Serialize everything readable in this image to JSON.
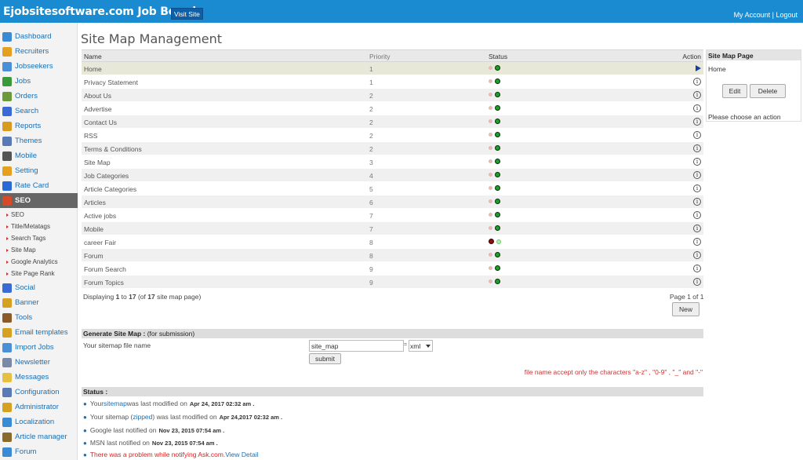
{
  "header": {
    "brand": "Ejobsitesoftware.com Job Board",
    "visit_site": "Visit Site",
    "my_account": "My Account",
    "separator": "|",
    "logout": "Logout"
  },
  "sidebar": {
    "items": [
      {
        "label": "Dashboard",
        "icon": "home-icon",
        "color": "#3a8ad6"
      },
      {
        "label": "Recruiters",
        "icon": "recruiter-icon",
        "color": "#e6a020"
      },
      {
        "label": "Jobseekers",
        "icon": "jobseekers-icon",
        "color": "#4a90d9"
      },
      {
        "label": "Jobs",
        "icon": "jobs-icon",
        "color": "#3a9a3a"
      },
      {
        "label": "Orders",
        "icon": "orders-icon",
        "color": "#6a9a3a"
      },
      {
        "label": "Search",
        "icon": "search-icon",
        "color": "#3a6ad6"
      },
      {
        "label": "Reports",
        "icon": "reports-icon",
        "color": "#d99a20"
      },
      {
        "label": "Themes",
        "icon": "themes-icon",
        "color": "#5a7ab6"
      },
      {
        "label": "Mobile",
        "icon": "mobile-icon",
        "color": "#555555"
      },
      {
        "label": "Setting",
        "icon": "gear-icon",
        "color": "#e6a020"
      },
      {
        "label": "Rate Card",
        "icon": "dollar-icon",
        "color": "#2a6ad6"
      },
      {
        "label": "SEO",
        "icon": "seo-icon",
        "color": "#d64a2a"
      }
    ],
    "seo_sub": [
      "SEO",
      "Title/Metatags",
      "Search Tags",
      "Site Map",
      "Google Analytics",
      "Site Page Rank"
    ],
    "items_after": [
      {
        "label": "Social",
        "icon": "social-icon",
        "color": "#3a6ad6"
      },
      {
        "label": "Banner",
        "icon": "banner-icon",
        "color": "#d6a020"
      },
      {
        "label": "Tools",
        "icon": "tools-icon",
        "color": "#8a5a2a"
      },
      {
        "label": "Email templates",
        "icon": "email-icon",
        "color": "#d6a020"
      },
      {
        "label": "Import Jobs",
        "icon": "import-icon",
        "color": "#4a90d9"
      },
      {
        "label": "Newsletter",
        "icon": "newsletter-icon",
        "color": "#7a8aa6"
      },
      {
        "label": "Messages",
        "icon": "messages-icon",
        "color": "#e6c040"
      },
      {
        "label": "Configuration",
        "icon": "configuration-icon",
        "color": "#5a7ab6"
      },
      {
        "label": "Administrator",
        "icon": "administrator-icon",
        "color": "#d6a020"
      },
      {
        "label": "Localization",
        "icon": "localization-icon",
        "color": "#3a8ad6"
      },
      {
        "label": "Article manager",
        "icon": "article-icon",
        "color": "#8a6a2a"
      },
      {
        "label": "Forum",
        "icon": "forum-icon",
        "color": "#3a8ad6"
      }
    ]
  },
  "main": {
    "title": "Site Map Management",
    "columns": {
      "name": "Name",
      "priority": "Priority",
      "status": "Status",
      "action": "Action"
    },
    "rows": [
      {
        "name": "Home",
        "priority": "1",
        "status": "on",
        "action": "play"
      },
      {
        "name": "Privacy Statement",
        "priority": "1",
        "status": "on",
        "action": "info"
      },
      {
        "name": "About Us",
        "priority": "2",
        "status": "on",
        "action": "info"
      },
      {
        "name": "Advertise",
        "priority": "2",
        "status": "on",
        "action": "info"
      },
      {
        "name": "Contact Us",
        "priority": "2",
        "status": "on",
        "action": "info"
      },
      {
        "name": "RSS",
        "priority": "2",
        "status": "on",
        "action": "info"
      },
      {
        "name": "Terms & Conditions",
        "priority": "2",
        "status": "on",
        "action": "info"
      },
      {
        "name": "Site Map",
        "priority": "3",
        "status": "on",
        "action": "info"
      },
      {
        "name": "Job Categories",
        "priority": "4",
        "status": "on",
        "action": "info"
      },
      {
        "name": "Article Categories",
        "priority": "5",
        "status": "on",
        "action": "info"
      },
      {
        "name": "Articles",
        "priority": "6",
        "status": "on",
        "action": "info"
      },
      {
        "name": "Active jobs",
        "priority": "7",
        "status": "on",
        "action": "info"
      },
      {
        "name": "Mobile",
        "priority": "7",
        "status": "on",
        "action": "info"
      },
      {
        "name": "career Fair",
        "priority": "8",
        "status": "off",
        "action": "info"
      },
      {
        "name": "Forum",
        "priority": "8",
        "status": "on",
        "action": "info"
      },
      {
        "name": "Forum Search",
        "priority": "9",
        "status": "on",
        "action": "info"
      },
      {
        "name": "Forum Topics",
        "priority": "9",
        "status": "on",
        "action": "info"
      }
    ],
    "displaying_prefix": "Displaying ",
    "displaying_from": "1",
    "displaying_to_word": " to ",
    "displaying_to": "17",
    "displaying_of_word": " (of ",
    "displaying_total": "17",
    "displaying_suffix": " site map page)",
    "pager": "Page 1 of 1",
    "new_button": "New"
  },
  "right_panel": {
    "title": "Site Map Page",
    "value": "Home",
    "edit": "Edit",
    "delete": "Delete",
    "message": "Please choose an action"
  },
  "generate": {
    "title_bold": "Generate Site Map :",
    "title_rest": " (for submission)",
    "label": "Your sitemap file name",
    "filename": "site_map",
    "equals": "=",
    "extension": "xml",
    "submit": "submit",
    "warning": "file name accept only the characters \"a-z\" , \"0-9\" , \"_\" and \"-\""
  },
  "status": {
    "title": "Status :",
    "line1_a": "Your ",
    "line1_link": "sitemap",
    "line1_b": " was last modified on",
    "line1_date": "Apr 24, 2017 02:32 am .",
    "line2_a": "Your sitemap (",
    "line2_link": "zipped",
    "line2_b": ") was last modified on",
    "line2_date": "Apr 24,2017 02:32 am .",
    "line3_a": "Google last notified on",
    "line3_date": "Nov 23, 2015 07:54 am .",
    "line4_a": "MSN last notified on",
    "line4_date": "Nov 23, 2015 07:54 am .",
    "line5_a": "There was a problem while notifying Ask.com.",
    "line5_link": "View Detail"
  }
}
